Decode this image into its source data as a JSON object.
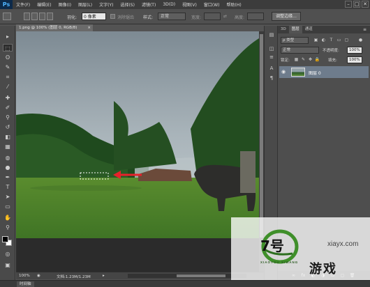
{
  "app": {
    "logo": "Ps"
  },
  "menu": [
    "文件(F)",
    "编辑(E)",
    "图像(I)",
    "图层(L)",
    "文字(Y)",
    "选择(S)",
    "滤镜(T)",
    "3D(D)",
    "视图(V)",
    "窗口(W)",
    "帮助(H)"
  ],
  "window_controls": {
    "minimize": "–",
    "maximize": "□",
    "close": "✕"
  },
  "options": {
    "feather_label": "羽化:",
    "feather_value": "0 像素",
    "antialias_label": "消除锯齿",
    "style_label": "样式:",
    "style_value": "正常",
    "width_label": "宽度:",
    "height_label": "高度:",
    "refine_edge": "调整边缘..."
  },
  "document": {
    "tab": "1.png @ 100% (图层 0, RGB/8)",
    "tab_close": "×",
    "zoom": "100%",
    "doc_info": "文档:1.23M/1.23M"
  },
  "timeline": {
    "tab": "时间轴"
  },
  "tools": [
    {
      "name": "move-tool",
      "glyph": "▸"
    },
    {
      "name": "marquee-tool",
      "glyph": "⬚"
    },
    {
      "name": "lasso-tool",
      "glyph": "ʘ"
    },
    {
      "name": "quick-select-tool",
      "glyph": "✎"
    },
    {
      "name": "crop-tool",
      "glyph": "⌗"
    },
    {
      "name": "eyedropper-tool",
      "glyph": "⁄"
    },
    {
      "name": "healing-tool",
      "glyph": "✚"
    },
    {
      "name": "brush-tool",
      "glyph": "✐"
    },
    {
      "name": "clone-stamp-tool",
      "glyph": "⚲"
    },
    {
      "name": "history-brush-tool",
      "glyph": "↺"
    },
    {
      "name": "eraser-tool",
      "glyph": "◧"
    },
    {
      "name": "gradient-tool",
      "glyph": "▦"
    },
    {
      "name": "blur-tool",
      "glyph": "◍"
    },
    {
      "name": "dodge-tool",
      "glyph": "●"
    },
    {
      "name": "pen-tool",
      "glyph": "✒"
    },
    {
      "name": "type-tool",
      "glyph": "T"
    },
    {
      "name": "path-select-tool",
      "glyph": "➤"
    },
    {
      "name": "shape-tool",
      "glyph": "▭"
    },
    {
      "name": "hand-tool",
      "glyph": "✋"
    },
    {
      "name": "zoom-tool",
      "glyph": "⚲"
    }
  ],
  "side_strip": [
    {
      "name": "history-icon",
      "glyph": "▤"
    },
    {
      "name": "properties-icon",
      "glyph": "◫"
    },
    {
      "name": "adjust-icon",
      "glyph": "≡"
    },
    {
      "name": "character-icon",
      "glyph": "A"
    },
    {
      "name": "paragraph-icon",
      "glyph": "¶"
    }
  ],
  "panel": {
    "tabs": [
      "3D",
      "图层",
      "通道"
    ],
    "kind_label": "ρ 类型",
    "blend_mode": "正常",
    "opacity_label": "不透明度:",
    "opacity_value": "100%",
    "lock_label": "锁定:",
    "fill_label": "填充:",
    "fill_value": "100%",
    "layer_name": "图层 0",
    "footer_icons": [
      "∞",
      "fx",
      "◐",
      "◑",
      "▭",
      "▢",
      "🗑"
    ]
  },
  "watermark": {
    "site": "xiayx.com",
    "sub": "XIAOYOU XIWANG",
    "game": "游戏",
    "logo_text": "7号"
  },
  "colors": {
    "accent": "#4fb3ff",
    "marching_ants": "#ffffff",
    "arrow": "#e8212b"
  }
}
